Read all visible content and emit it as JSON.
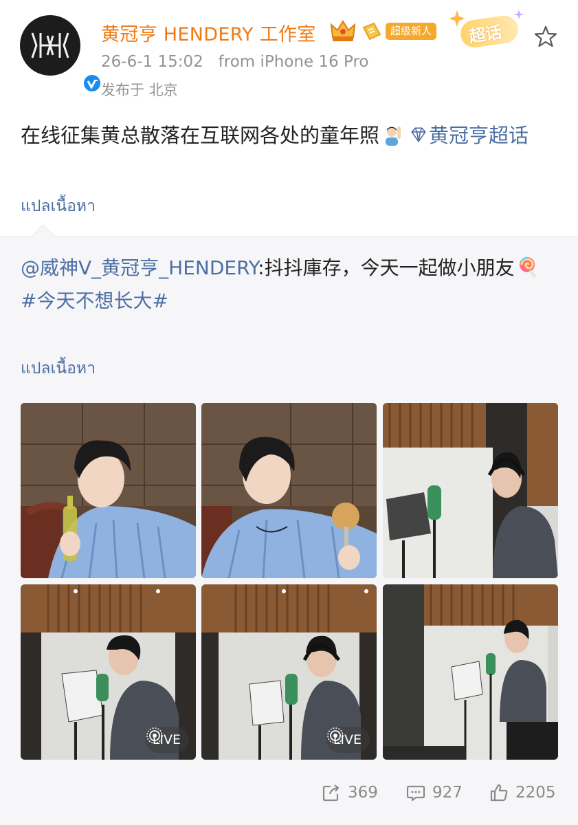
{
  "header": {
    "user_name": "黄冠亨 HENDERY 工作室",
    "badge_newbie": "超级新人",
    "badge_super_topic": "超话",
    "meta": "26-6-1 15:02   from iPhone 16 Pro",
    "location": "发布于 北京"
  },
  "post": {
    "text": "在线征集黄总散落在互联网各处的童年照",
    "topic_link": "黄冠亨超话",
    "translate": "แปลเนื้อหา"
  },
  "repost": {
    "mention": "@威神V_黄冠亨_HENDERY",
    "text": ":抖抖庫存，今天一起做小朋友",
    "hashtag": "#今天不想长大#",
    "translate": "แปลเนื้อหา"
  },
  "photos": [
    {
      "live": ""
    },
    {
      "live": ""
    },
    {
      "live": ""
    },
    {
      "live": "LIVE"
    },
    {
      "live": "LIVE"
    },
    {
      "live": ""
    }
  ],
  "actions": {
    "reposts": "369",
    "comments": "927",
    "likes": "2205"
  },
  "colors": {
    "user_name": "#ef7a16",
    "link": "#4c6fa3",
    "meta": "#939393",
    "verified": "#1a8cf0",
    "badge_newbie": "#f4a92c"
  },
  "icons": [
    "crown-icon",
    "ticket-icon",
    "star-icon",
    "verified-icon",
    "repost-icon",
    "comment-icon",
    "like-icon",
    "live-icon",
    "diamond-icon",
    "raising-hand-emoji",
    "lollipop-emoji"
  ]
}
